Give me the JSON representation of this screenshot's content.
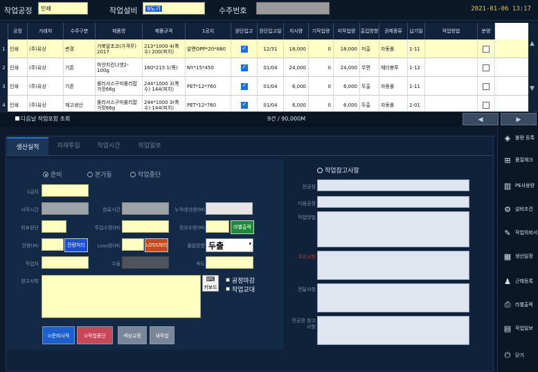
{
  "top": {
    "process_label": "작업공정",
    "process_value": "인쇄",
    "equipment_label": "작업설비",
    "equipment_value": "9도기",
    "order_label": "수주번호",
    "order_value": "",
    "datetime": "2021-01-06 13:17"
  },
  "grid": {
    "columns": [
      "공정",
      "거래처",
      "수주구분",
      "제품명",
      "제품규격",
      "1공지",
      "원단입고",
      "원단입고일",
      "지시량",
      "기작업량",
      "미작업량",
      "출입방향",
      "권제종류",
      "납기일",
      "작업방법",
      "분량"
    ],
    "rows": [
      {
        "no": "1",
        "process": "인쇄",
        "customer": "(주)유상",
        "type": "변경",
        "product": "거북알초코(가격무) 2017",
        "spec": "213*1000 4(폭수) 200(피치)",
        "material": "알면OPP*20*880",
        "in_checked": true,
        "in_date": "12/31",
        "qty": "18,000",
        "done": "0",
        "remain": "18,000",
        "direction": "미출",
        "roll": "자동롤",
        "due": "1-11",
        "method": "",
        "bundle_checked": false
      },
      {
        "no": "2",
        "process": "인쇄",
        "customer": "(주)유상",
        "type": "기존",
        "product": "하얀치킨너겟2-100g",
        "spec": "160*215 1(폭)",
        "material": "NY*15*450",
        "in_checked": true,
        "in_date": "01/04",
        "qty": "24,000",
        "done": "0",
        "remain": "24,000",
        "direction": "무편",
        "roll": "헤더봉투",
        "due": "1-12",
        "method": "",
        "bundle_checked": false
      },
      {
        "no": "3",
        "process": "인쇄",
        "customer": "(주)유상",
        "type": "기존",
        "product": "롤리서스구미롤리팝 가맛66g",
        "spec": "244*1000 3(폭수) 144(피치)",
        "material": "PET*12*760",
        "in_checked": true,
        "in_date": "01/04",
        "qty": "6,000",
        "done": "0",
        "remain": "6,000",
        "direction": "두출",
        "roll": "자동롤",
        "due": "1-11",
        "method": "",
        "bundle_checked": false
      },
      {
        "no": "4",
        "process": "인쇄",
        "customer": "(주)유상",
        "type": "재고생산",
        "product": "롤리서스구미롤리팝 가맛66g",
        "spec": "244*1000 3(폭수) 144(피치)",
        "material": "PET*12*760",
        "in_checked": true,
        "in_date": "01/04",
        "qty": "6,000",
        "done": "0",
        "remain": "6,000",
        "direction": "두출",
        "roll": "자동롤",
        "due": "1-01",
        "method": "",
        "bundle_checked": false
      }
    ]
  },
  "status": {
    "next_day_label": "다음날 작업포함 조회",
    "count": "9건  /  90,000M",
    "prev": "◀",
    "next": "▶"
  },
  "tabs": [
    "생산실적",
    "자재투입",
    "작업시간",
    "작업일보"
  ],
  "form": {
    "radio_ready": "준비",
    "radio_run": "본가동",
    "radio_stop": "작업중단",
    "l_paper": "1급지",
    "l_start": "시작시간",
    "l_end": "완료시간",
    "l_total": "누적생산량(M)",
    "l_roll": "회표원단",
    "l_input": "투입수량(M)",
    "l_normal": "정상수량(M)",
    "btn_label": "라벨출력",
    "l_remain": "잔량(M)",
    "btn_remain": "잔량처리",
    "l_loss": "Loss량(M)",
    "btn_loss": "LOSS처리",
    "l_direction": "풀림방향",
    "direction_value": "두출",
    "l_worker": "작업자",
    "l_count": "수율",
    "l_speed": "속도",
    "l_note": "참고사항",
    "keyboard": "키보드",
    "chk_close": "공정마감",
    "chk_shift": "작업교대",
    "btn_start": "준비시작",
    "btn_stop": "작업중단",
    "btn_color": "색상교정",
    "btn_new": "새작업"
  },
  "info": {
    "title": "작업참고사항",
    "l_prev": "전공정",
    "l_next": "다음공정",
    "l_method": "작업방법",
    "l_caution": "주의사항",
    "l_deliver": "전달사항",
    "l_prev_note": "전공정 참고사항"
  },
  "sidebar": [
    {
      "icon": "defect-icon",
      "glyph": "◈",
      "label": "불량 등록"
    },
    {
      "icon": "quality-icon",
      "glyph": "⊞",
      "label": "품질체크"
    },
    {
      "icon": "pe-icon",
      "glyph": "▥",
      "label": "PE사용량"
    },
    {
      "icon": "gear-icon",
      "glyph": "⚙",
      "label": "설비조건"
    },
    {
      "icon": "edit-icon",
      "glyph": "✎",
      "label": "작업의뢰서"
    },
    {
      "icon": "calendar-icon",
      "glyph": "▦",
      "label": "생산일정"
    },
    {
      "icon": "people-icon",
      "glyph": "♟",
      "label": "근태등록"
    },
    {
      "icon": "print-icon",
      "glyph": "⎙",
      "label": "라벨출력"
    },
    {
      "icon": "report-icon",
      "glyph": "▤",
      "label": "작업일보"
    },
    {
      "icon": "power-icon",
      "glyph": "⏻",
      "label": "닫기"
    }
  ]
}
